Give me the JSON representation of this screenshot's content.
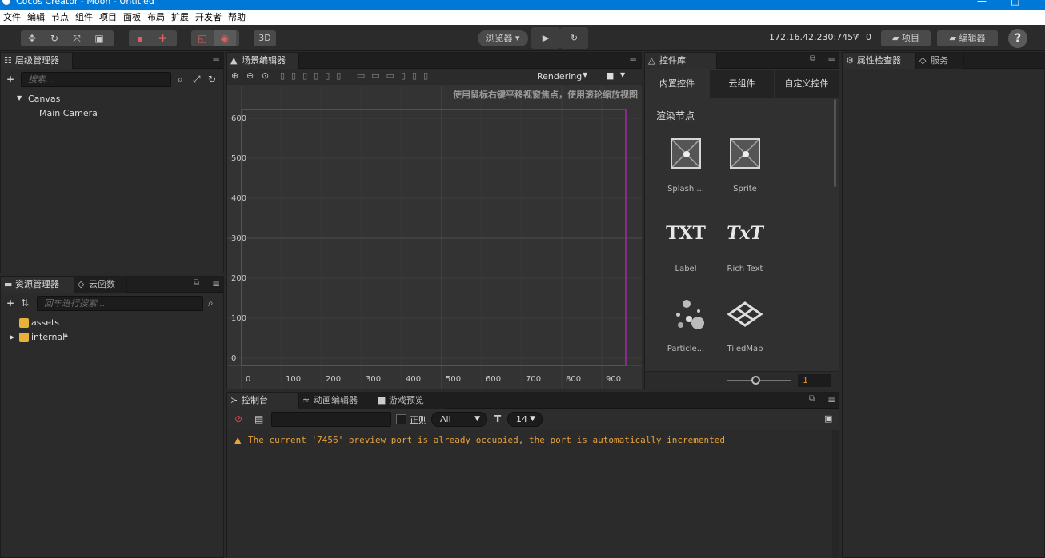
{
  "window": {
    "title": "Cocos Creator - Moon - Untitled",
    "minimize_glyph": "—",
    "maximize_glyph": "□"
  },
  "menu": [
    "文件",
    "编辑",
    "节点",
    "组件",
    "项目",
    "面板",
    "布局",
    "扩展",
    "开发者",
    "帮助"
  ],
  "toolbar": {
    "browser_label": "浏览器 ▾",
    "three_d_label": "3D",
    "ip": "172.16.42.230:7457",
    "wifi_count": "0",
    "project_label": "项目",
    "editor_label": "编辑器",
    "help_label": "?"
  },
  "hierarchy": {
    "tab_label": "层级管理器",
    "search_placeholder": "搜索...",
    "tree": [
      {
        "label": "Canvas",
        "expanded": true
      },
      {
        "label": "Main Camera"
      }
    ]
  },
  "assets": {
    "tab_label": "资源管理器",
    "tab2_label": "云函数",
    "search_placeholder": "回车进行搜索...",
    "tree": [
      {
        "label": "assets"
      },
      {
        "label": "internal",
        "locked": true
      }
    ]
  },
  "scene": {
    "tab_label": "场景编辑器",
    "hint": "使用鼠标右键平移视窗焦点，使用滚轮缩放视图",
    "rendering_label": "Rendering",
    "y_ticks": [
      "600",
      "500",
      "400",
      "300",
      "200",
      "100",
      "0"
    ],
    "x_ticks": [
      "0",
      "100",
      "200",
      "300",
      "400",
      "500",
      "600",
      "700",
      "800",
      "900"
    ]
  },
  "widgets": {
    "tab_label": "控件库",
    "tabs": [
      "内置控件",
      "云组件",
      "自定义控件"
    ],
    "section": "渲染节点",
    "items": [
      "Splash ...",
      "Sprite",
      "Label",
      "Rich Text",
      "Particle...",
      "TiledMap"
    ],
    "label_glyph": "TXT",
    "richtext_glyph": "TxT",
    "zoom_value": "1"
  },
  "inspector": {
    "tab_label": "属性检查器",
    "tab2_label": "服务"
  },
  "console": {
    "tabs": [
      "控制台",
      "动画编辑器",
      "游戏预览"
    ],
    "regex_label": "正则",
    "level_value": "All",
    "font_size_value": "14",
    "message": "The current '7456' preview port is already occupied, the port is automatically incremented",
    "warn_color": "#e8a33d"
  }
}
